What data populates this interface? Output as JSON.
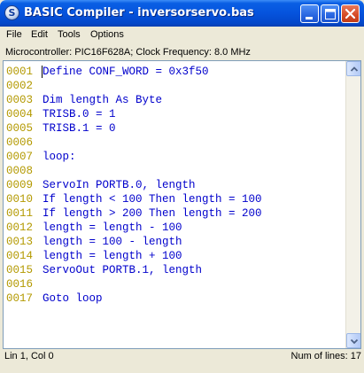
{
  "window": {
    "title": "BASIC Compiler - inversorservo.bas",
    "app_icon_glyph": "S"
  },
  "menu": {
    "items": [
      "File",
      "Edit",
      "Tools",
      "Options"
    ]
  },
  "info": {
    "text": "Microcontroller: PIC16F628A;  Clock Frequency: 8.0 MHz"
  },
  "editor": {
    "lines": [
      {
        "num": "0001",
        "code": "Define CONF_WORD = 0x3f50"
      },
      {
        "num": "0002",
        "code": ""
      },
      {
        "num": "0003",
        "code": "Dim length As Byte"
      },
      {
        "num": "0004",
        "code": "TRISB.0 = 1"
      },
      {
        "num": "0005",
        "code": "TRISB.1 = 0"
      },
      {
        "num": "0006",
        "code": ""
      },
      {
        "num": "0007",
        "code": "loop:"
      },
      {
        "num": "0008",
        "code": ""
      },
      {
        "num": "0009",
        "code": "ServoIn PORTB.0, length"
      },
      {
        "num": "0010",
        "code": "If length < 100 Then length = 100"
      },
      {
        "num": "0011",
        "code": "If length > 200 Then length = 200"
      },
      {
        "num": "0012",
        "code": "length = length - 100"
      },
      {
        "num": "0013",
        "code": "length = 100 - length"
      },
      {
        "num": "0014",
        "code": "length = length + 100"
      },
      {
        "num": "0015",
        "code": "ServoOut PORTB.1, length"
      },
      {
        "num": "0016",
        "code": ""
      },
      {
        "num": "0017",
        "code": "Goto loop"
      }
    ]
  },
  "status": {
    "position": "Lin 1, Col 0",
    "num_lines": "Num of lines: 17"
  },
  "colors": {
    "line_number": "#b39900",
    "keyword": "#0000cc",
    "code_text": "#0000cc",
    "title_bar": "#0553dd"
  }
}
